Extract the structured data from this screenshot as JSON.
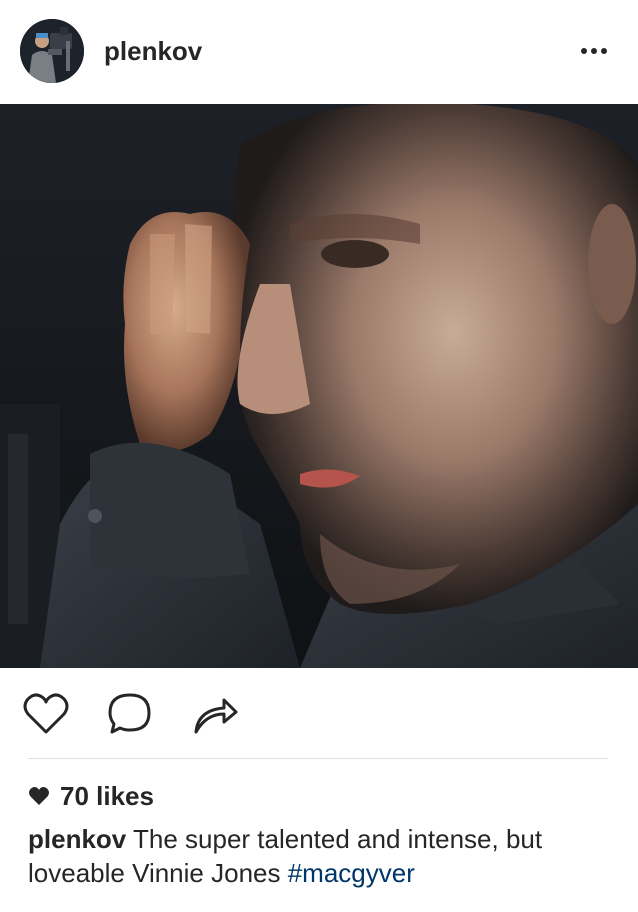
{
  "post": {
    "username": "plenkov",
    "more_icon": "more-horizontal-icon",
    "photo_subject": "",
    "actions": {
      "like_icon": "heart-outline-icon",
      "comment_icon": "comment-bubble-icon",
      "share_icon": "share-arrow-icon"
    },
    "likes": {
      "icon": "heart-filled-icon",
      "text": "70 likes"
    },
    "caption": {
      "username": "plenkov",
      "text_line1": "The super talented and intense, but",
      "text_line2": "loveable Vinnie Jones",
      "hashtag": "#macgyver"
    }
  },
  "colors": {
    "text": "#262626",
    "hashtag": "#003569",
    "divider": "#e0e0e0",
    "background": "#ffffff"
  }
}
